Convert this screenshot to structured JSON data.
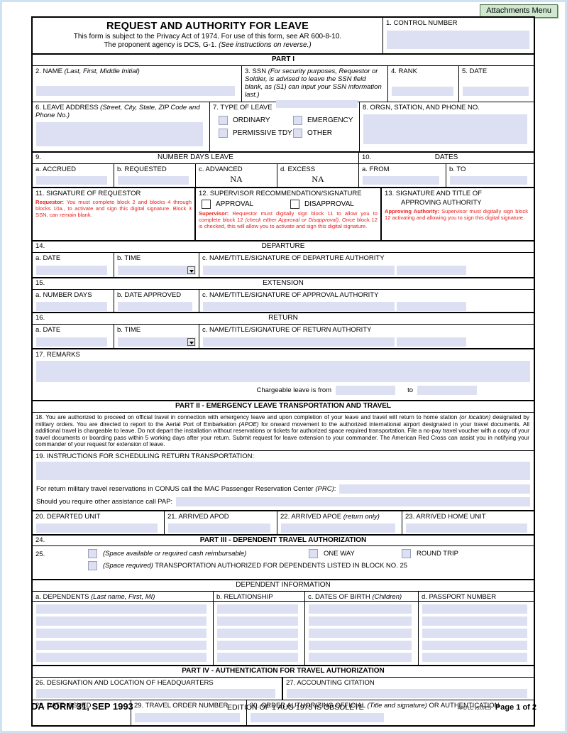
{
  "toolbar": {
    "attachments_menu": "Attachments Menu"
  },
  "header": {
    "title": "REQUEST AND AUTHORITY FOR LEAVE",
    "subtitle1": "This form is subject to the Privacy Act of 1974. For use of this form, see AR 600-8-10.",
    "subtitle2_plain": "The proponent agency is DCS, G-1. ",
    "subtitle2_italic": "(See instructions on reverse.)",
    "control_number_label": "1. CONTROL NUMBER"
  },
  "part1": {
    "bar": "PART I",
    "name_label": "2.  NAME  ",
    "name_label_italic": "(Last, First, Middle Initial)",
    "ssn_label": "3.  SSN  ",
    "ssn_label_italic": "(For security purposes, Requestor or Soldier, is advised to leave the SSN field blank, as (S1) can input your SSN information last.)",
    "rank_label": "4.  RANK",
    "date_label": "5.  DATE",
    "leave_address_label": "6.  LEAVE ADDRESS  ",
    "leave_address_italic": "(Street, City, State, ZIP Code and Phone No.)",
    "type_of_leave_label": "7.  TYPE OF LEAVE",
    "type_options": [
      "ORDINARY",
      "EMERGENCY",
      "PERMISSIVE TDY",
      "OTHER"
    ],
    "orgn_label": "8.  ORGN, STATION, AND PHONE NO.",
    "days_num": "9.",
    "days_title": "NUMBER DAYS LEAVE",
    "days_a": "a.  ACCRUED",
    "days_b": "b.  REQUESTED",
    "days_c": "c.  ADVANCED",
    "days_d": "d.  EXCESS",
    "days_c_value": "NA",
    "days_d_value": "NA",
    "dates_num": "10.",
    "dates_title": "DATES",
    "dates_a": "a.  FROM",
    "dates_b": "b.  TO",
    "sig_requestor_label": "11.  SIGNATURE OF REQUESTOR",
    "sig_requestor_red_name": "Requestor:",
    "sig_requestor_red_body": " You must complete block 2 and blocks 4 through blocks 10a., to activate and sign this digital signature. Block 3 SSN, can remain blank.",
    "supervisor_label": "12.  SUPERVISOR RECOMMENDATION/SIGNATURE",
    "supervisor_options": [
      "APPROVAL",
      "DISAPPROVAL"
    ],
    "supervisor_red_name": "Supervisor:",
    "supervisor_red_body1": " Requestor must digitally sign block 11 to allow you to complete block 12 ",
    "supervisor_red_italic": "(check either Approval or Disapproval)",
    "supervisor_red_body2": ". Once block 12 is checked, this will allow you to activate and sign this digital signature.",
    "approving_label_l1": "13.  SIGNATURE AND TITLE OF",
    "approving_label_l2": "APPROVING AUTHORITY",
    "approving_red_name": "Approving Authority:",
    "approving_red_body": " Supervisor must digitally sign block 12 activating and allowing you to sign this digital signature."
  },
  "departure": {
    "num": "14.",
    "title": "DEPARTURE",
    "a": "a.  DATE",
    "b": "b.  TIME",
    "c": "c.  NAME/TITLE/SIGNATURE OF DEPARTURE AUTHORITY"
  },
  "extension": {
    "num": "15.",
    "title": "EXTENSION",
    "a": "a.  NUMBER DAYS",
    "b": "b.  DATE APPROVED",
    "c": "c.  NAME/TITLE/SIGNATURE OF APPROVAL AUTHORITY"
  },
  "return_sec": {
    "num": "16.",
    "title": "RETURN",
    "a": "a.  DATE",
    "b": "b.  TIME",
    "c": "c.  NAME/TITLE/SIGNATURE OF RETURN AUTHORITY"
  },
  "remarks": {
    "label": "17.  REMARKS",
    "chargeable_from": "Chargeable leave is from",
    "chargeable_to": "to"
  },
  "part2": {
    "bar": "PART II - EMERGENCY LEAVE TRANSPORTATION AND TRAVEL",
    "item18_num": "18.",
    "item18_p1": "You are authorized to proceed on official travel in connection with emergency leave and upon completion of your leave and travel will return to home station ",
    "item18_i1": "(or location)",
    "item18_p2": " designated by military orders. You are directed to report to the Aerial Port of Embarkation ",
    "item18_i2": "(APOE)",
    "item18_p3": " for onward movement to the authorized international airport designated in your travel documents. All additional travel is chargeable to leave. Do not depart the installation without reservations or tickets for authorized space required transportation. File a no-pay travel voucher with a copy of your travel documents or boarding pass within 5 working days after your return. Submit request for leave extension to your commander. The American Red Cross can assist you in notifying your commander of your request for extension of leave.",
    "item19": "19.  INSTRUCTIONS FOR SCHEDULING RETURN TRANSPORTATION:",
    "prc_text": "For return military travel reservations in CONUS call the MAC Passenger Reservation Center ",
    "prc_italic": "(PRC)",
    "prc_colon": ":",
    "pap_text": "Should you require other assistance call PAP:",
    "b20": "20.  DEPARTED UNIT",
    "b21": "21.  ARRIVED APOD",
    "b22": "22.  ARRIVED APOE ",
    "b22_italic": "(return only)",
    "b23": "23.  ARRIVED HOME UNIT"
  },
  "part3": {
    "num": "24.",
    "bar": "PART III - DEPENDENT TRAVEL AUTHORIZATION",
    "item25_num": "25.",
    "opt1_italic": "(Space available or required cash reimbursable)",
    "opt_one_way": "ONE WAY",
    "opt_round_trip": "ROUND TRIP",
    "opt2_italic": "(Space required)",
    "opt2_text": " TRANSPORTATION AUTHORIZED FOR DEPENDENTS LISTED IN BLOCK NO. 25",
    "dep_info_title": "DEPENDENT INFORMATION",
    "col_a": "a.  DEPENDENTS  ",
    "col_a_italic": "(Last name, First, MI)",
    "col_b": "b.  RELATIONSHIP",
    "col_c": "c.  DATES OF BIRTH ",
    "col_c_italic": "(Children)",
    "col_d": "d.  PASSPORT NUMBER",
    "row_count": 5
  },
  "part4": {
    "bar": "PART IV - AUTHENTICATION FOR TRAVEL AUTHORIZATION",
    "b26": "26.  DESIGNATION AND LOCATION OF HEADQUARTERS",
    "b27": "27.  ACCOUNTING CITATION",
    "b28": "28.  DATE ISSUED",
    "b29": "29.  TRAVEL ORDER NUMBER",
    "b30": "30.  ORDER AUTHORIZING OFFICIAL ",
    "b30_italic": "(Title and signature)",
    "b30_tail": " OR AUTHENTICATION"
  },
  "footer": {
    "form_id": "DA FORM 31, SEP 1993",
    "edition": "EDITION OF 1 AUG 1975 IS OBSOLETE",
    "apd": "APD LC v5.07ES",
    "page": "Page 1 of 2"
  },
  "colors": {
    "field_fill": "#dce0f2",
    "red_instruction": "#e8201e",
    "attach_button": "#cfe8cf",
    "page_edge": "#cfe2f2"
  }
}
